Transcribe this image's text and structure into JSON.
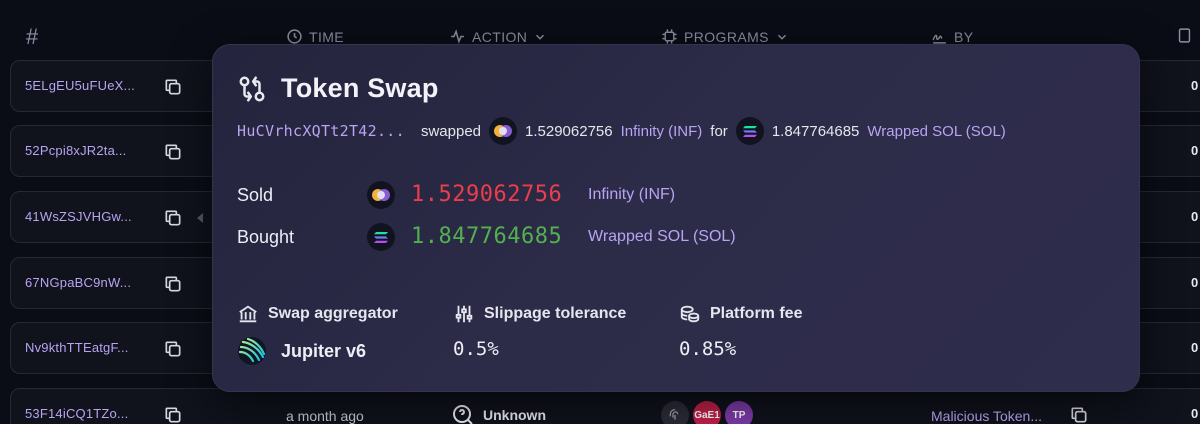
{
  "table": {
    "headers": {
      "hash": "#",
      "time": "TIME",
      "action": "ACTION",
      "programs": "PROGRAMS",
      "by": "BY"
    },
    "rows": [
      {
        "signature": "5ELgEU5uFUeX...",
        "tail": "0"
      },
      {
        "signature": "52Pcpi8xJR2ta...",
        "tail": "0"
      },
      {
        "signature": "41WsZSJVHGw...",
        "tail": "0"
      },
      {
        "signature": "67NGpaBC9nW...",
        "tail": "0"
      },
      {
        "signature": "Nv9kthTTEatgF...",
        "tail": "0"
      },
      {
        "signature": "53F14iCQ1TZo...",
        "tail": "0",
        "time": "a month ago",
        "action": "Unknown",
        "programs": [
          "GaE1",
          "TP"
        ],
        "by": "Malicious Token..."
      }
    ]
  },
  "swap": {
    "title": "Token Swap",
    "summary": {
      "address": "HuCVrhcXQTt2T42...",
      "verb": "swapped",
      "sold_amount": "1.529062756",
      "sold_token": "Infinity (INF)",
      "connector": "for",
      "bought_amount": "1.847764685",
      "bought_token": "Wrapped SOL (SOL)"
    },
    "sold": {
      "label": "Sold",
      "amount": "1.529062756",
      "token": "Infinity (INF)"
    },
    "bought": {
      "label": "Bought",
      "amount": "1.847764685",
      "token": "Wrapped SOL (SOL)"
    },
    "aggregator": {
      "label": "Swap aggregator",
      "value": "Jupiter v6"
    },
    "slippage": {
      "label": "Slippage tolerance",
      "value": "0.5%"
    },
    "fee": {
      "label": "Platform fee",
      "value": "0.85%"
    }
  },
  "colors": {
    "accent": "#b8a4f2",
    "sold": "#ec3d4c",
    "bought": "#53b04e",
    "card": "#2c2b48",
    "background": "#0b0d16"
  }
}
